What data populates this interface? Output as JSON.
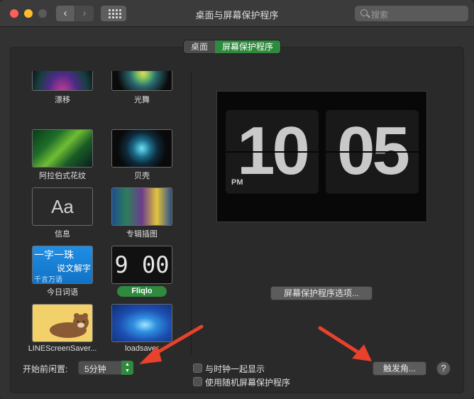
{
  "window": {
    "title": "桌面与屏幕保护程序"
  },
  "search": {
    "placeholder": "搜索"
  },
  "tabs": [
    {
      "label": "桌面",
      "active": false
    },
    {
      "label": "屏幕保护程序",
      "active": true
    }
  ],
  "savers": [
    {
      "label": "漂移",
      "icon": "drift-thumbnail"
    },
    {
      "label": "光舞",
      "icon": "flurry-thumbnail"
    },
    {
      "label": "阿拉伯式花纹",
      "icon": "arabesque-thumbnail"
    },
    {
      "label": "贝壳",
      "icon": "shell-thumbnail"
    },
    {
      "label": "信息",
      "icon": "message-thumbnail",
      "thumb_text": "Aa"
    },
    {
      "label": "专辑插图",
      "icon": "album-artwork-thumbnail"
    },
    {
      "label": "今日词语",
      "icon": "word-of-day-thumbnail",
      "thumb_lines": [
        "一字一珠",
        "说文解字",
        "千言万语"
      ]
    },
    {
      "label": "Fliqlo",
      "icon": "fliqlo-thumbnail",
      "thumb_text": "9 00",
      "selected": true
    },
    {
      "label": "LINEScreenSaver...",
      "icon": "line-thumbnail"
    },
    {
      "label": "loadsaver",
      "icon": "loadsaver-thumbnail"
    }
  ],
  "preview": {
    "hour": "10",
    "minute": "05",
    "ampm": "PM"
  },
  "buttons": {
    "options": "屏幕保护程序选项...",
    "hot_corners": "触发角...",
    "help": "?"
  },
  "idle": {
    "label": "开始前闲置:",
    "value": "5分钟"
  },
  "checkboxes": {
    "show_clock": {
      "label": "与时钟一起显示",
      "checked": false
    },
    "random": {
      "label": "使用随机屏幕保护程序",
      "checked": false
    }
  },
  "colors": {
    "accent": "#2f8a3e",
    "annotation_arrow": "#e8412c"
  }
}
